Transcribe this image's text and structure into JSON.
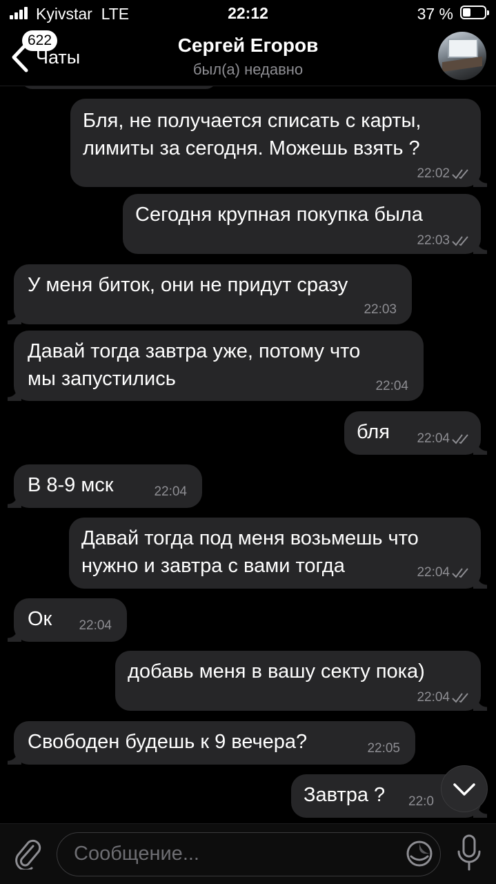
{
  "status": {
    "carrier": "Kyivstar",
    "network": "LTE",
    "time": "22:12",
    "battery": "37 %"
  },
  "header": {
    "back_badge": "622",
    "back_label": "Чаты",
    "title": "Сергей Егоров",
    "subtitle": "был(а) недавно"
  },
  "messages": [
    {
      "side": "out",
      "text": "Бля, не получается списать с карты,\nлимиты за сегодня. Можешь взять ?",
      "time": "22:02",
      "read": true
    },
    {
      "side": "out",
      "text": "Сегодня крупная покупка была",
      "time": "22:03",
      "read": true
    },
    {
      "side": "in",
      "text": "У меня биток, они не придут сразу",
      "time": "22:03"
    },
    {
      "side": "in",
      "text": "Давай тогда завтра уже, потому что\nмы запустились",
      "time": "22:04"
    },
    {
      "side": "out",
      "text": "бля",
      "time": "22:04",
      "read": true
    },
    {
      "side": "in",
      "text": "В 8-9 мск",
      "time": "22:04"
    },
    {
      "side": "out",
      "text": "Давай тогда под меня возьмешь что\nнужно и завтра с вами тогда",
      "time": "22:04",
      "read": true
    },
    {
      "side": "in",
      "text": "Ок",
      "time": "22:04"
    },
    {
      "side": "out",
      "text": "добавь меня в вашу секту пока)",
      "time": "22:04",
      "read": true
    },
    {
      "side": "in",
      "text": "Свободен будешь к 9 вечера?",
      "time": "22:05"
    },
    {
      "side": "out",
      "text": "Завтра ?",
      "time": "22:0",
      "read": true
    }
  ],
  "composer": {
    "placeholder": "Сообщение..."
  },
  "icons": {
    "back": "chevron-left-icon",
    "scroll": "chevron-down-icon",
    "attach": "paperclip-icon",
    "sticker": "sticker-icon",
    "mic": "microphone-icon"
  },
  "colors": {
    "background": "#000000",
    "bubble": "#262628",
    "meta": "#8e8e93"
  }
}
